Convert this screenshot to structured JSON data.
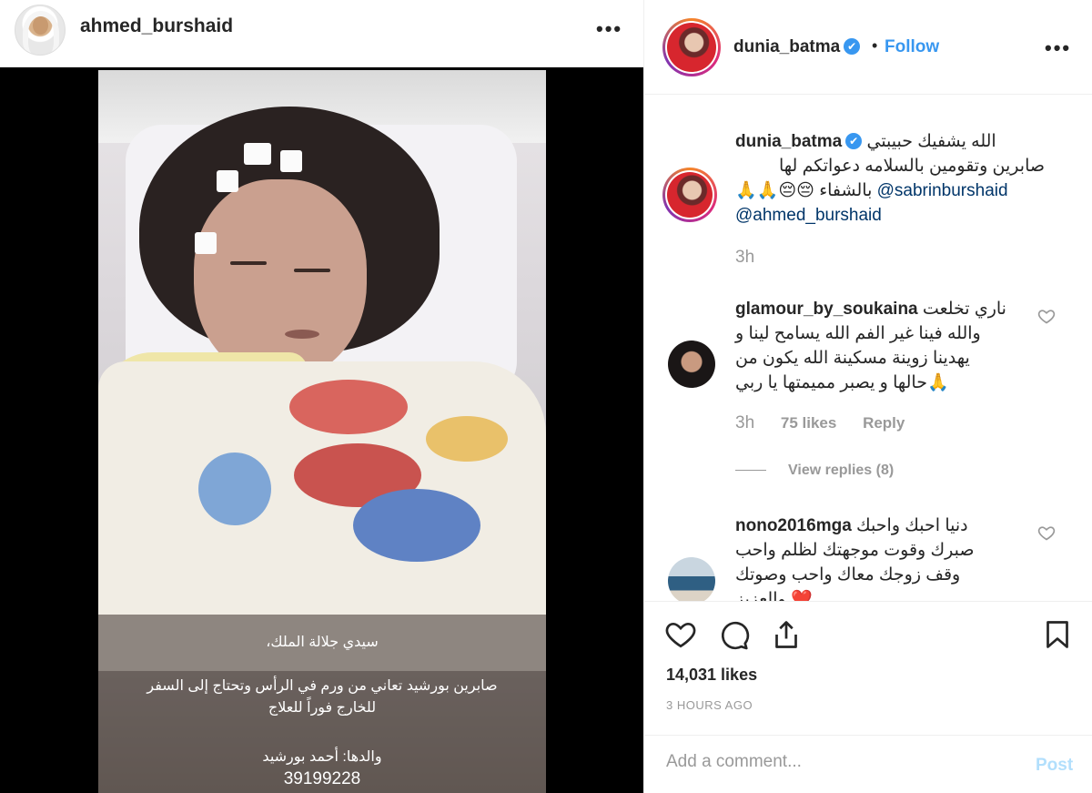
{
  "post_owner": {
    "username": "ahmed_burshaid",
    "more_icon": "ellipsis-icon"
  },
  "photo": {
    "caption_line1": "سيدي جلالة الملك،",
    "caption_line2": "صابرين بورشيد تعاني من ورم في الرأس وتحتاج إلى السفر",
    "caption_line3": "للخارج فوراً للعلاج",
    "caption_line4": "والدها: أحمد بورشيد",
    "caption_phone": "39199228"
  },
  "viewer_header": {
    "username": "dunia_batma",
    "verified": "✔",
    "separator": "•",
    "follow_label": "Follow"
  },
  "comments": [
    {
      "username": "dunia_batma",
      "verified": "✔",
      "text_line1": "الله يشفيك حبيبتي",
      "text_line2": "صابرين وتقومين بالسلامه دعواتكم لها",
      "text_line3_ar": "بالشفاء 😔😔🙏🙏",
      "mention1": "@sabrinburshaid",
      "mention2": "@ahmed_burshaid",
      "time": "3h"
    },
    {
      "username": "glamour_by_soukaina",
      "text_line1": "ناري تخلعت",
      "text_line2": "والله فينا غير الفم الله يسامح لينا و",
      "text_line3": "يهدينا زوينة مسكينة الله يكون من",
      "text_line4": "🙏حالها و يصبر مميمتها يا ربي",
      "time": "3h",
      "likes": "75 likes",
      "reply": "Reply",
      "view_replies": "View replies (8)"
    },
    {
      "username": "nono2016mga",
      "text_line1": "دنيا احبك واحبك",
      "text_line2": "صبرك وقوت موجهتك لظلم واحب",
      "text_line3": "وقف زوجك معاك واحب وصوتك",
      "text_line4": "❤️ والعزيز"
    }
  ],
  "actions": {
    "likes": "14,031 likes",
    "time_ago": "3 HOURS AGO"
  },
  "add_comment": {
    "placeholder": "Add a comment...",
    "post_label": "Post"
  },
  "colors": {
    "link_blue": "#3897f0",
    "text": "#262626",
    "muted": "#999999",
    "border": "#efefef"
  }
}
